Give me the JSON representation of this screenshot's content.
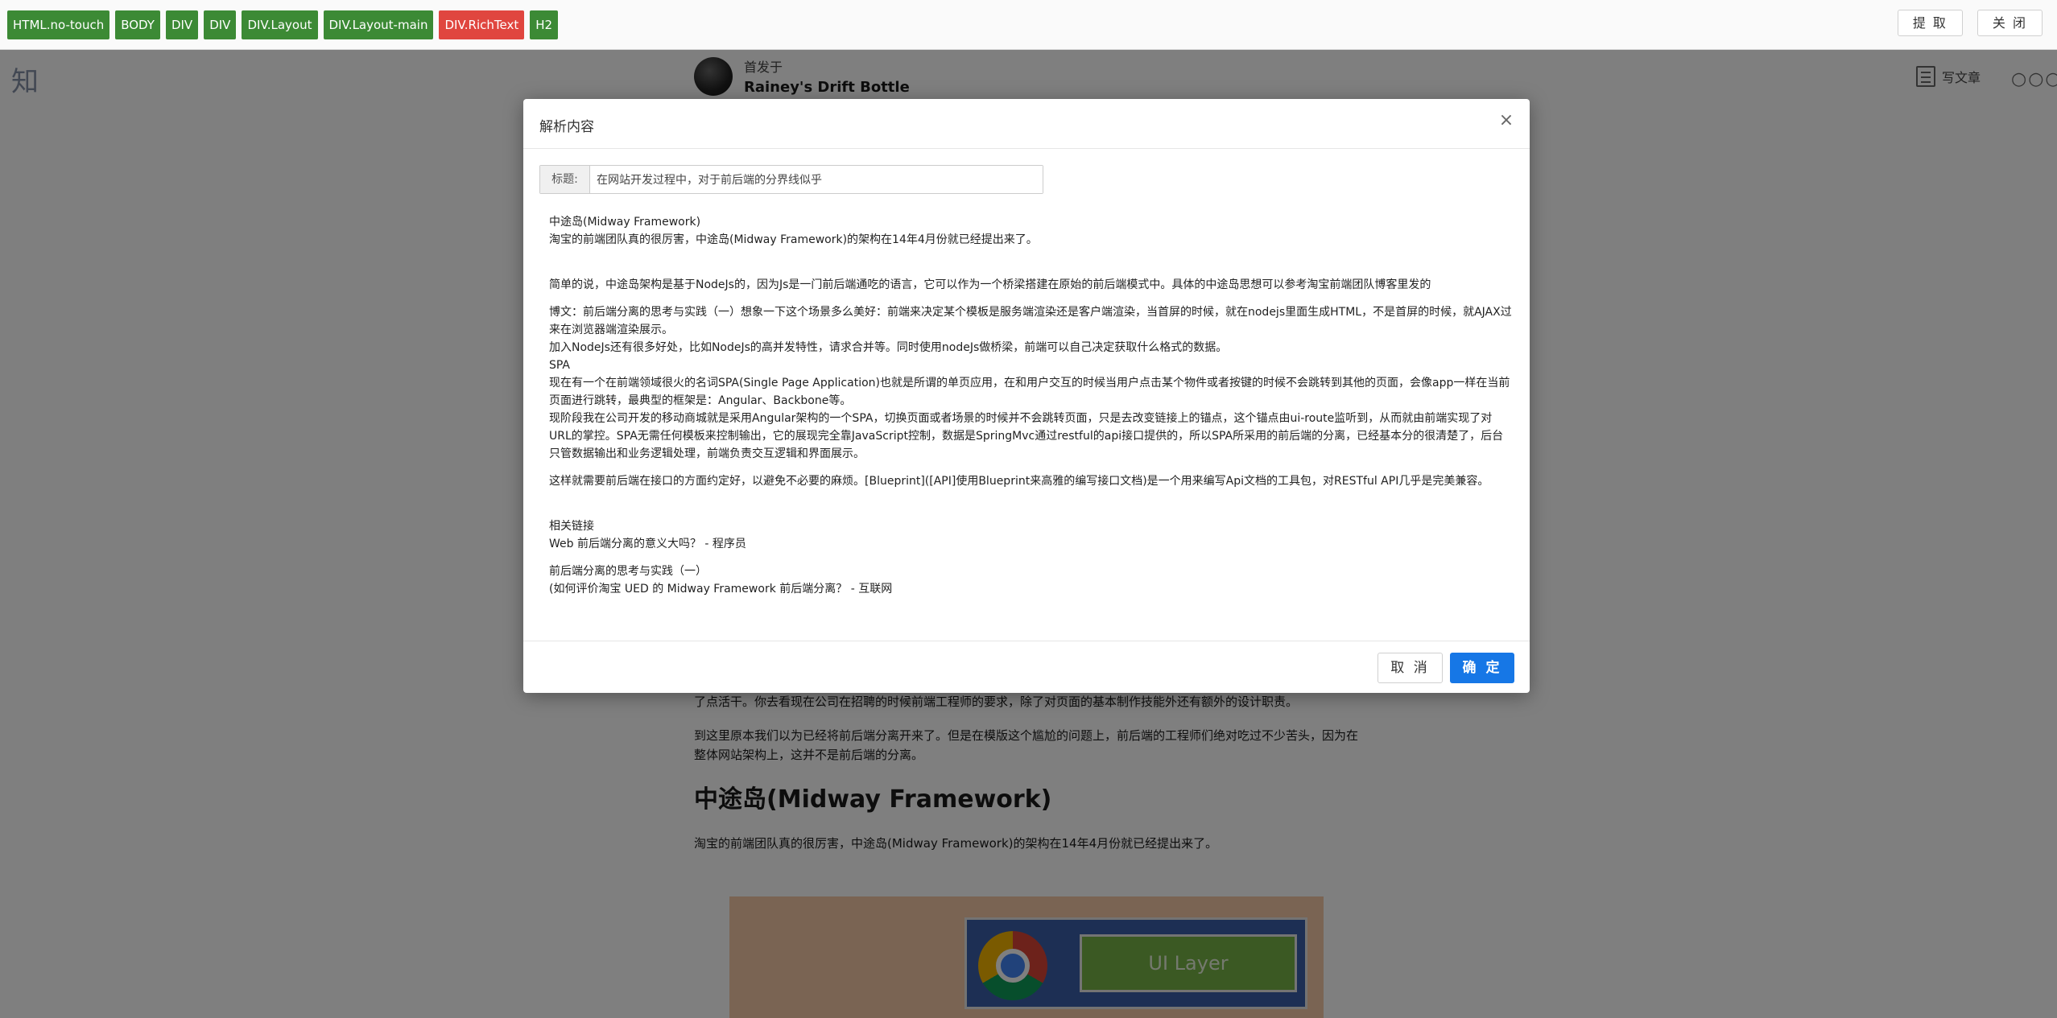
{
  "page": {
    "logo": "知",
    "author_prefix": "首发于",
    "author_name": "Rainey's Drift Bottle",
    "write_label": "写文章",
    "more": "○○○"
  },
  "article": {
    "p1": "了点活干。你去看现在公司在招聘的时候前端工程师的要求，除了对页面的基本制作技能外还有额外的设计职责。",
    "p2": "到这里原本我们以为已经将前后端分离开来了。但是在模版这个尴尬的问题上，前后端的工程师们绝对吃过不少苦头，因为在整体网站架构上，这并不是前后端的分离。",
    "heading": "中途岛(Midway Framework)",
    "p3": "淘宝的前端团队真的很厉害，中途岛(Midway Framework)的架构在14年4月份就已经提出来了。",
    "figure_label": "UI Layer"
  },
  "toolbar": {
    "tags": [
      {
        "label": "HTML.no-touch",
        "active": false
      },
      {
        "label": "BODY",
        "active": false
      },
      {
        "label": "DIV",
        "active": false
      },
      {
        "label": "DIV",
        "active": false
      },
      {
        "label": "DIV.Layout",
        "active": false
      },
      {
        "label": "DIV.Layout-main",
        "active": false
      },
      {
        "label": "DIV.RichText",
        "active": true
      },
      {
        "label": "H2",
        "active": false
      }
    ],
    "extract_label": "提 取",
    "close_label": "关 闭",
    "active_color": "#e0463f",
    "tag_color": "#3c8a35"
  },
  "modal": {
    "title": "解析内容",
    "close": "×",
    "title_label": "标题:",
    "title_value": "在网站开发过程中，对于前后端的分界线似乎",
    "content": {
      "l1": "中途岛(Midway Framework)",
      "l2": "淘宝的前端团队真的很厉害，中途岛(Midway Framework)的架构在14年4月份就已经提出来了。",
      "l3": "简单的说，中途岛架构是基于NodeJs的，因为Js是一门前后端通吃的语言，它可以作为一个桥梁搭建在原始的前后端模式中。具体的中途岛思想可以参考淘宝前端团队博客里发的",
      "l4": "博文：前后端分离的思考与实践（一）想象一下这个场景多么美好：前端来决定某个模板是服务端渲染还是客户端渲染，当首屏的时候，就在nodejs里面生成HTML，不是首屏的时候，就AJAX过来在浏览器端渲染展示。",
      "l5": "加入NodeJs还有很多好处，比如NodeJs的高并发特性，请求合并等。同时使用nodeJs做桥梁，前端可以自己决定获取什么格式的数据。",
      "l6": "SPA",
      "l7": "现在有一个在前端领域很火的名词SPA(Single Page Application)也就是所谓的单页应用，在和用户交互的时候当用户点击某个物件或者按键的时候不会跳转到其他的页面，会像app一样在当前页面进行跳转，最典型的框架是：Angular、Backbone等。",
      "l8": "现阶段我在公司开发的移动商城就是采用Angular架构的一个SPA，切换页面或者场景的时候并不会跳转页面，只是去改变链接上的锚点，这个锚点由ui-route监听到，从而就由前端实现了对URL的掌控。SPA无需任何模板来控制输出，它的展现完全靠JavaScript控制，数据是SpringMvc通过restful的api接口提供的，所以SPA所采用的前后端的分离，已经基本分的很清楚了，后台只管数据输出和业务逻辑处理，前端负责交互逻辑和界面展示。",
      "l9": "这样就需要前后端在接口的方面约定好，以避免不必要的麻烦。[Blueprint]([API]使用Blueprint来高雅的编写接口文档)是一个用来编写Api文档的工具包，对RESTful API几乎是完美兼容。",
      "l10": "相关链接",
      "l11": "Web 前后端分离的意义大吗？ - 程序员",
      "l12": "前后端分离的思考与实践（一）",
      "l13": "(如何评价淘宝 UED 的 Midway Framework 前后端分离？ - 互联网"
    },
    "cancel_label": "取 消",
    "ok_label": "确 定",
    "ok_color": "#1677e6"
  }
}
